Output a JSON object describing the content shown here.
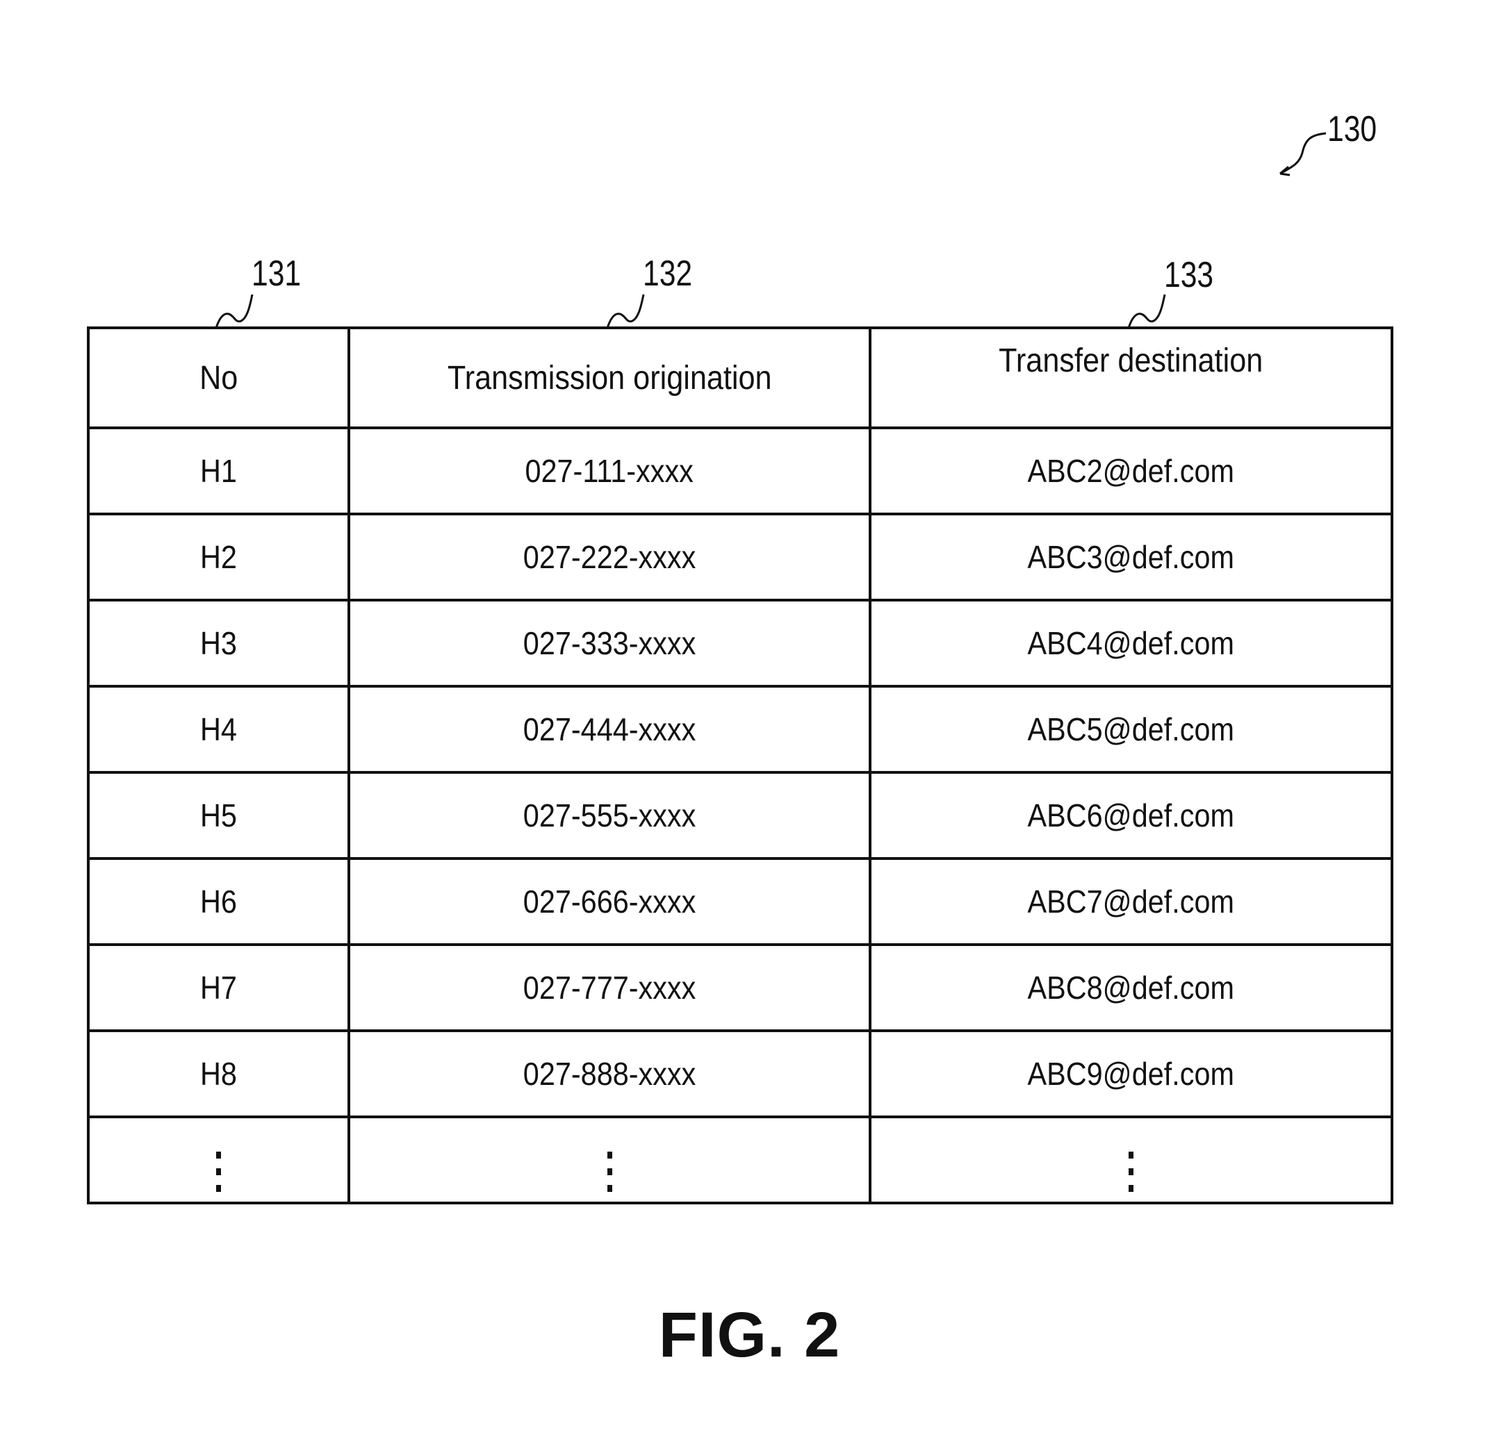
{
  "figure": {
    "label": "FIG. 2",
    "reference_numerals": {
      "table": "130",
      "column_no": "131",
      "column_origination": "132",
      "column_destination": "133"
    }
  },
  "table": {
    "headers": [
      "No",
      "Transmission origination",
      "Transfer destination"
    ],
    "rows": [
      [
        "H1",
        "027-111-xxxx",
        "ABC2@def.com"
      ],
      [
        "H2",
        "027-222-xxxx",
        "ABC3@def.com"
      ],
      [
        "H3",
        "027-333-xxxx",
        "ABC4@def.com"
      ],
      [
        "H4",
        "027-444-xxxx",
        "ABC5@def.com"
      ],
      [
        "H5",
        "027-555-xxxx",
        "ABC6@def.com"
      ],
      [
        "H6",
        "027-666-xxxx",
        "ABC7@def.com"
      ],
      [
        "H7",
        "027-777-xxxx",
        "ABC8@def.com"
      ],
      [
        "H8",
        "027-888-xxxx",
        "ABC9@def.com"
      ]
    ],
    "continuation": "vertical-ellipsis"
  }
}
